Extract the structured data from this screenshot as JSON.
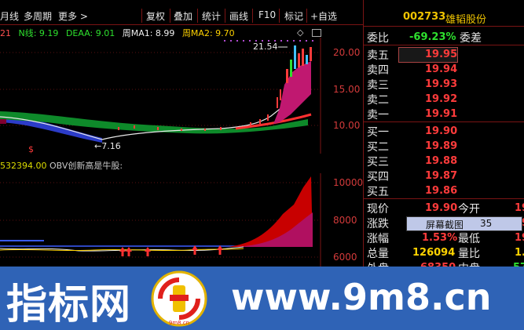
{
  "toolbar": {
    "items": [
      "月线",
      "多周期",
      "更多 >",
      "复权",
      "叠加",
      "统计",
      "画线",
      "F10",
      "标记",
      "+自选"
    ]
  },
  "indicator": {
    "prefix": "21",
    "n_line": "N线: 9.19",
    "deaa": "DEAA: 9.01",
    "ma1": "周MA1: 8.99",
    "ma2": "周MA2: 9.70"
  },
  "main_chart": {
    "price_axis": [
      "20.00",
      "15.00",
      "10.00"
    ],
    "high_label": "21.54",
    "low_label": "←7.16",
    "marker": "$"
  },
  "obv": {
    "value": "532394.00",
    "text": "OBV创新高是牛股:"
  },
  "lower_chart": {
    "axis": [
      "10000",
      "8000",
      "6000"
    ]
  },
  "stock": {
    "code": "002733",
    "name": "雄韬股份"
  },
  "orderbook": {
    "webi_label": "委比",
    "webi_value": "-69.23%",
    "wecha_label": "委差",
    "sells": [
      {
        "label": "卖五",
        "price": "19.95"
      },
      {
        "label": "卖四",
        "price": "19.94"
      },
      {
        "label": "卖三",
        "price": "19.93"
      },
      {
        "label": "卖二",
        "price": "19.92"
      },
      {
        "label": "卖一",
        "price": "19.91"
      }
    ],
    "buys": [
      {
        "label": "买一",
        "price": "19.90"
      },
      {
        "label": "买二",
        "price": "19.89"
      },
      {
        "label": "买三",
        "price": "19.88"
      },
      {
        "label": "买四",
        "price": "19.87"
      },
      {
        "label": "买五",
        "price": "19.86"
      }
    ]
  },
  "quote": {
    "xianjia_label": "现价",
    "xianjia": "19.90",
    "jinkai_label": "今开",
    "jinkai": "19",
    "zhangdie_label": "涨跌",
    "zuigao_label": "最高",
    "zuigao": "19",
    "zhangfu_label": "涨幅",
    "zhangfu": "1.53%",
    "zuidi_label": "最低",
    "zuidi": "19",
    "zongliang_label": "总量",
    "zongliang": "126094",
    "liangbi_label": "量比",
    "liangbi": "1.",
    "waipan_label": "外盘",
    "waipan": "68350",
    "neipan_label": "内盘",
    "neipan": "57"
  },
  "popup": {
    "button": "屏幕截图",
    "number": "35"
  },
  "banner": {
    "left_text": "指标网",
    "right_text": "www.9m8.cn",
    "logo_text": "9m8.cn"
  },
  "colors": {
    "up_red": "#ff3b3b",
    "down_green": "#2ee02e",
    "accent_yellow": "#ffd200",
    "banner_blue": "#2f63b6"
  }
}
